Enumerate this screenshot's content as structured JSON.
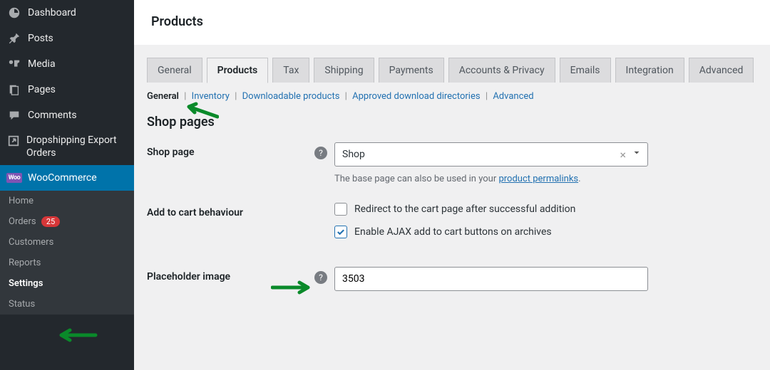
{
  "sidebar": {
    "dashboard": "Dashboard",
    "posts": "Posts",
    "media": "Media",
    "pages": "Pages",
    "comments": "Comments",
    "dropship": "Dropshipping Export Orders",
    "woo": "WooCommerce",
    "sub": {
      "home": "Home",
      "orders": "Orders",
      "orders_badge": "25",
      "customers": "Customers",
      "reports": "Reports",
      "settings": "Settings",
      "status": "Status"
    }
  },
  "header": {
    "title": "Products"
  },
  "tabs": [
    "General",
    "Products",
    "Tax",
    "Shipping",
    "Payments",
    "Accounts & Privacy",
    "Emails",
    "Integration",
    "Advanced"
  ],
  "subnav": {
    "general": "General",
    "inventory": "Inventory",
    "downloadable": "Downloadable products",
    "approved": "Approved download directories",
    "advanced": "Advanced"
  },
  "section": {
    "heading": "Shop pages"
  },
  "shop_page": {
    "label": "Shop page",
    "value": "Shop",
    "hint_a": "The base page can also be used in your ",
    "hint_link": "product permalinks",
    "hint_b": "."
  },
  "add_to_cart": {
    "label": "Add to cart behaviour",
    "redirect": "Redirect to the cart page after successful addition",
    "ajax": "Enable AJAX add to cart buttons on archives"
  },
  "placeholder": {
    "label": "Placeholder image",
    "value": "3503"
  }
}
